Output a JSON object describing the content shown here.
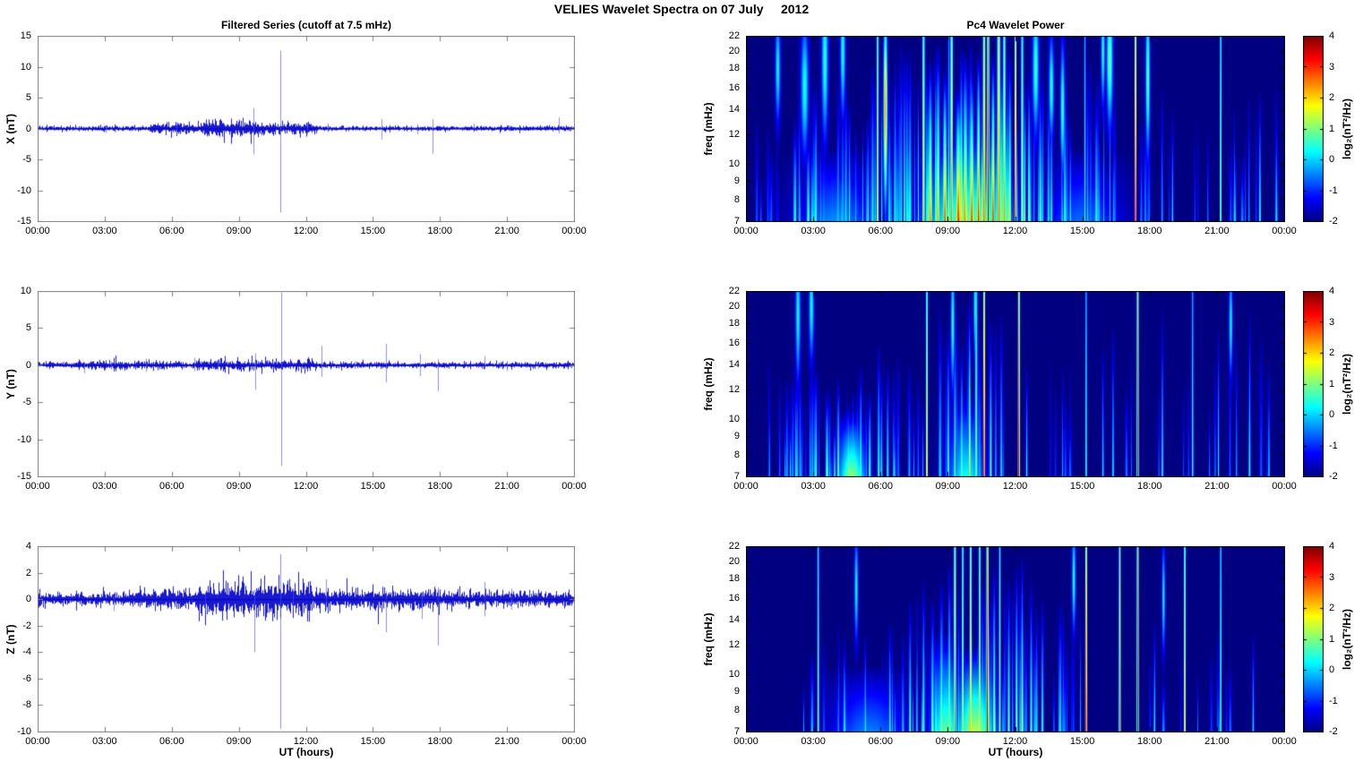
{
  "figure": {
    "title": "VELIES Wavelet Spectra on 07 July     2012",
    "date_shown": "07 July 2012",
    "background": "#ffffff"
  },
  "time_axis": {
    "label": "UT (hours)",
    "range_hours": [
      0,
      24
    ],
    "tick_hours": [
      0,
      3,
      6,
      9,
      12,
      15,
      18,
      21,
      24
    ],
    "tick_labels": [
      "00:00",
      "03:00",
      "06:00",
      "09:00",
      "12:00",
      "15:00",
      "18:00",
      "21:00",
      "00:00"
    ]
  },
  "colorbar": {
    "label": "log₂(nT²/Hz)",
    "clim": [
      -2,
      4
    ],
    "ticks": [
      -2,
      -1,
      0,
      1,
      2,
      3,
      4
    ],
    "colormap": "jet"
  },
  "colors": {
    "series_line": "#0000cc",
    "series_core": "#0000bb",
    "spike_line": "rgba(80,80,235,0.65)",
    "series_axis": "#7d7d7d",
    "spect_axis": "#000000",
    "spect_background_value": -2
  },
  "chart_data": [
    {
      "id": "x-filtered-series",
      "type": "line",
      "title": "Filtered Series (cutoff at 7.5 mHz)",
      "ylabel": "X (nT)",
      "ylim": [
        -15,
        15
      ],
      "yticks": [
        -15,
        -10,
        -5,
        0,
        5,
        10,
        15
      ],
      "x_unit": "UT hours, 0-24",
      "seed": 11,
      "noise": {
        "base": 0.12,
        "bursts": [
          [
            5.0,
            7.3,
            0.28
          ],
          [
            7.3,
            9.9,
            0.42
          ],
          [
            9.9,
            12.5,
            0.32
          ]
        ]
      },
      "spikes": [
        [
          3.05,
          0.5,
          -0.7
        ],
        [
          6.2,
          0.6,
          -1.0
        ],
        [
          9.64,
          3.3,
          -4.2
        ],
        [
          10.87,
          12.6,
          -13.6
        ],
        [
          12.05,
          0.9,
          -0.9
        ],
        [
          13.0,
          0.8,
          -0.6
        ],
        [
          15.4,
          1.5,
          -1.8
        ],
        [
          17.0,
          0.7,
          -0.9
        ],
        [
          17.65,
          1.5,
          -4.1
        ],
        [
          19.5,
          0.8,
          -0.6
        ],
        [
          21.1,
          0.5,
          -0.5
        ],
        [
          23.3,
          1.8,
          -0.8
        ]
      ]
    },
    {
      "id": "y-filtered-series",
      "type": "line",
      "ylabel": "Y (nT)",
      "ylim": [
        -15,
        10
      ],
      "yticks": [
        -15,
        -10,
        -5,
        0,
        5,
        10
      ],
      "x_unit": "UT hours, 0-24",
      "seed": 12,
      "noise": {
        "base": 0.12,
        "bursts": [
          [
            1.8,
            6.5,
            0.18
          ],
          [
            7.0,
            12.5,
            0.22
          ]
        ]
      },
      "spikes": [
        [
          2.1,
          0.4,
          -1.1
        ],
        [
          3.3,
          0.5,
          -0.6
        ],
        [
          4.85,
          0.9,
          -0.9
        ],
        [
          7.0,
          1.0,
          -0.8
        ],
        [
          8.05,
          0.7,
          -0.7
        ],
        [
          9.75,
          1.6,
          -3.3
        ],
        [
          10.9,
          9.8,
          -13.6
        ],
        [
          12.7,
          2.6,
          -1.6
        ],
        [
          14.2,
          0.5,
          -0.5
        ],
        [
          15.6,
          2.9,
          -2.3
        ],
        [
          17.1,
          1.5,
          -1.5
        ],
        [
          17.9,
          0.8,
          -3.5
        ],
        [
          20.0,
          1.2,
          -0.6
        ],
        [
          21.0,
          0.6,
          -0.8
        ],
        [
          22.4,
          0.5,
          -0.5
        ]
      ]
    },
    {
      "id": "z-filtered-series",
      "type": "line",
      "ylabel": "Z (nT)",
      "ylim": [
        -10,
        4
      ],
      "yticks": [
        -10,
        -8,
        -6,
        -4,
        -2,
        0,
        2,
        4
      ],
      "x_unit": "UT hours, 0-24",
      "seed": 13,
      "noise": {
        "base": 0.15,
        "bursts": [
          [
            4.2,
            7.2,
            0.24
          ],
          [
            7.2,
            12.3,
            0.4
          ],
          [
            12.3,
            18.0,
            0.24
          ],
          [
            18.0,
            24.0,
            0.19
          ]
        ]
      },
      "spikes": [
        [
          3.4,
          0.3,
          -0.9
        ],
        [
          7.5,
          0.4,
          -0.9
        ],
        [
          9.7,
          0.7,
          -4.0
        ],
        [
          10.87,
          3.4,
          -9.8
        ],
        [
          11.4,
          0.8,
          -0.6
        ],
        [
          12.9,
          1.5,
          -0.8
        ],
        [
          15.6,
          0.6,
          -2.5
        ],
        [
          17.2,
          0.5,
          -1.5
        ],
        [
          17.9,
          0.9,
          -3.5
        ],
        [
          20.0,
          1.3,
          -1.3
        ],
        [
          21.2,
          0.8,
          -0.8
        ]
      ]
    },
    {
      "id": "x-wavelet-power",
      "type": "heatmap",
      "title": "Pc4 Wavelet Power",
      "ylabel": "freq (mHz)",
      "yscale": "log",
      "ylim_mhz": [
        7,
        22
      ],
      "yticks": [
        7,
        8,
        9,
        10,
        12,
        14,
        16,
        18,
        20,
        22
      ],
      "clim": [
        -2,
        4
      ],
      "seed": 21,
      "events": [
        [
          5.85,
          0.03,
          2.2,
          22
        ],
        [
          7.9,
          0.04,
          2.2,
          22
        ],
        [
          8.2,
          0.06,
          2.6,
          19
        ],
        [
          8.55,
          0.05,
          2.4,
          21
        ],
        [
          8.85,
          0.06,
          3.0,
          18
        ],
        [
          9.15,
          0.04,
          2.6,
          22
        ],
        [
          9.45,
          0.08,
          3.2,
          16
        ],
        [
          9.75,
          0.05,
          2.8,
          20
        ],
        [
          10.05,
          0.06,
          3.1,
          18
        ],
        [
          10.35,
          0.05,
          3.3,
          20
        ],
        [
          10.6,
          0.04,
          3.0,
          22
        ],
        [
          10.78,
          0.035,
          4.0,
          22
        ],
        [
          11.0,
          0.05,
          3.2,
          20
        ],
        [
          11.25,
          0.05,
          2.8,
          22
        ],
        [
          11.5,
          0.04,
          2.4,
          22
        ],
        [
          11.75,
          0.04,
          2.0,
          20
        ],
        [
          12.0,
          0.03,
          3.6,
          22
        ],
        [
          12.3,
          0.04,
          1.8,
          22
        ],
        [
          12.6,
          0.04,
          1.4,
          18
        ],
        [
          13.1,
          0.04,
          1.0,
          18
        ],
        [
          13.6,
          0.04,
          0.6,
          16
        ],
        [
          14.2,
          0.04,
          0.8,
          18
        ],
        [
          15.1,
          0.025,
          0.9,
          22
        ],
        [
          15.6,
          0.04,
          0.7,
          16
        ],
        [
          17.35,
          0.03,
          3.8,
          22
        ],
        [
          19.0,
          0.03,
          0.3,
          14
        ],
        [
          21.15,
          0.025,
          1.8,
          22
        ],
        [
          22.9,
          0.03,
          0.8,
          16
        ]
      ],
      "wide": [
        [
          9.9,
          1.5,
          0.9,
          12.5
        ],
        [
          4.0,
          1.2,
          -0.4,
          11
        ],
        [
          15.0,
          1.2,
          -0.6,
          11
        ]
      ],
      "blobs": [
        [
          16.2,
          0.1,
          0.9,
          19,
          0.25
        ],
        [
          17.9,
          0.07,
          0.8,
          17,
          0.3
        ],
        [
          15.9,
          0.06,
          0.5,
          20,
          0.2
        ],
        [
          2.6,
          0.12,
          0.4,
          16,
          0.25
        ],
        [
          1.4,
          0.08,
          0.3,
          18,
          0.2
        ],
        [
          12.9,
          0.1,
          0.6,
          18,
          0.25
        ],
        [
          13.6,
          0.08,
          0.5,
          16,
          0.2
        ],
        [
          14.1,
          0.07,
          0.6,
          14,
          0.25
        ],
        [
          3.5,
          0.1,
          0.5,
          19,
          0.3
        ],
        [
          4.3,
          0.08,
          0.4,
          20,
          0.25
        ],
        [
          6.2,
          0.06,
          2.4,
          14,
          0.35
        ]
      ],
      "texture": [
        [
          0.3,
          2.0,
          10,
          -1.2,
          -0.4,
          9,
          14
        ],
        [
          2.0,
          5.5,
          30,
          -0.6,
          0.9,
          10,
          18
        ],
        [
          5.5,
          7.5,
          24,
          -0.4,
          1.2,
          12,
          22
        ],
        [
          7.5,
          12.8,
          60,
          -0.2,
          2.0,
          13,
          22
        ],
        [
          12.8,
          16.5,
          28,
          -0.7,
          0.7,
          10,
          20
        ],
        [
          16.5,
          20.5,
          8,
          -0.9,
          0.2,
          11,
          19
        ],
        [
          20.5,
          23.8,
          12,
          -0.8,
          0.4,
          10,
          17
        ]
      ]
    },
    {
      "id": "y-wavelet-power",
      "type": "heatmap",
      "ylabel": "freq (mHz)",
      "yscale": "log",
      "ylim_mhz": [
        7,
        22
      ],
      "yticks": [
        7,
        8,
        9,
        10,
        12,
        14,
        16,
        18,
        20,
        22
      ],
      "clim": [
        -2,
        4
      ],
      "seed": 22,
      "events": [
        [
          2.2,
          0.03,
          0.5,
          13
        ],
        [
          3.1,
          0.04,
          0.8,
          14
        ],
        [
          3.6,
          0.05,
          1.0,
          12
        ],
        [
          4.1,
          0.04,
          1.2,
          13
        ],
        [
          4.55,
          0.05,
          1.3,
          11
        ],
        [
          4.8,
          0.06,
          1.2,
          10.5
        ],
        [
          5.1,
          0.04,
          1.0,
          14
        ],
        [
          5.5,
          0.04,
          1.1,
          12
        ],
        [
          5.9,
          0.04,
          0.8,
          16
        ],
        [
          6.3,
          0.04,
          0.6,
          14
        ],
        [
          8.05,
          0.03,
          2.4,
          22
        ],
        [
          9.0,
          0.04,
          0.9,
          18
        ],
        [
          9.3,
          0.04,
          1.0,
          20
        ],
        [
          9.6,
          0.04,
          1.1,
          16
        ],
        [
          9.95,
          0.035,
          2.2,
          21
        ],
        [
          10.25,
          0.04,
          1.2,
          22
        ],
        [
          10.6,
          0.03,
          3.7,
          22
        ],
        [
          10.9,
          0.035,
          1.0,
          18
        ],
        [
          12.15,
          0.03,
          3.8,
          22
        ],
        [
          12.5,
          0.03,
          0.6,
          14
        ],
        [
          15.15,
          0.025,
          1.0,
          22
        ],
        [
          15.9,
          0.03,
          0.4,
          16
        ],
        [
          16.35,
          0.03,
          0.5,
          18
        ],
        [
          17.45,
          0.03,
          3.6,
          22
        ],
        [
          18.55,
          0.03,
          0.6,
          20
        ],
        [
          19.9,
          0.025,
          0.8,
          22
        ],
        [
          21.05,
          0.025,
          0.6,
          18
        ],
        [
          22.45,
          0.025,
          0.7,
          20
        ],
        [
          23.3,
          0.03,
          0.3,
          14
        ]
      ],
      "wide": [
        [
          4.7,
          0.45,
          1.1,
          10.5
        ],
        [
          9.8,
          0.6,
          0.3,
          12
        ]
      ],
      "blobs": [
        [
          2.3,
          0.08,
          0.3,
          19,
          0.25
        ],
        [
          2.9,
          0.08,
          0.35,
          20,
          0.2
        ],
        [
          9.2,
          0.06,
          0.5,
          18,
          0.25
        ],
        [
          10.2,
          0.05,
          0.4,
          20,
          0.2
        ],
        [
          21.6,
          0.06,
          0.3,
          18,
          0.2
        ]
      ],
      "texture": [
        [
          1.0,
          6.6,
          34,
          -0.6,
          0.8,
          9,
          16
        ],
        [
          6.6,
          8.0,
          8,
          -0.8,
          0.2,
          10,
          15
        ],
        [
          8.6,
          11.5,
          20,
          -0.5,
          0.8,
          12,
          22
        ],
        [
          12.3,
          14.8,
          7,
          -0.9,
          0.0,
          10,
          16
        ],
        [
          15.3,
          23.5,
          12,
          -0.9,
          0.1,
          10,
          18
        ]
      ]
    },
    {
      "id": "z-wavelet-power",
      "type": "heatmap",
      "ylabel": "freq (mHz)",
      "yscale": "log",
      "ylim_mhz": [
        7,
        22
      ],
      "yticks": [
        7,
        8,
        9,
        10,
        12,
        14,
        16,
        18,
        20,
        22
      ],
      "clim": [
        -2,
        4
      ],
      "seed": 23,
      "events": [
        [
          3.2,
          0.03,
          1.4,
          22
        ],
        [
          4.4,
          0.03,
          0.5,
          12
        ],
        [
          5.3,
          0.03,
          0.6,
          13
        ],
        [
          6.4,
          0.035,
          0.8,
          14
        ],
        [
          7.3,
          0.04,
          0.9,
          16
        ],
        [
          7.9,
          0.04,
          1.0,
          18
        ],
        [
          8.3,
          0.05,
          1.2,
          16
        ],
        [
          8.7,
          0.05,
          1.4,
          18
        ],
        [
          9.05,
          0.04,
          1.6,
          20
        ],
        [
          9.3,
          0.035,
          2.6,
          22
        ],
        [
          9.65,
          0.03,
          2.0,
          22
        ],
        [
          10.0,
          0.035,
          2.6,
          22
        ],
        [
          10.4,
          0.03,
          2.2,
          22
        ],
        [
          10.75,
          0.035,
          4.0,
          22
        ],
        [
          11.05,
          0.04,
          1.6,
          20
        ],
        [
          11.3,
          0.03,
          1.6,
          22
        ],
        [
          11.7,
          0.04,
          1.2,
          18
        ],
        [
          12.05,
          0.04,
          1.4,
          20
        ],
        [
          12.3,
          0.035,
          1.8,
          21
        ],
        [
          12.7,
          0.04,
          1.0,
          18
        ],
        [
          13.2,
          0.04,
          0.8,
          16
        ],
        [
          14.0,
          0.035,
          0.6,
          16
        ],
        [
          15.15,
          0.03,
          3.7,
          22
        ],
        [
          16.65,
          0.03,
          2.6,
          22
        ],
        [
          17.45,
          0.03,
          3.8,
          22
        ],
        [
          18.2,
          0.03,
          0.5,
          14
        ],
        [
          19.55,
          0.03,
          2.4,
          22
        ],
        [
          21.15,
          0.025,
          1.3,
          22
        ],
        [
          22.6,
          0.03,
          0.4,
          13
        ]
      ],
      "wide": [
        [
          10.2,
          0.65,
          1.3,
          12
        ],
        [
          8.9,
          0.5,
          0.8,
          13
        ],
        [
          5.5,
          1.2,
          -0.5,
          10.5
        ]
      ],
      "blobs": [
        [
          4.9,
          0.06,
          0.3,
          17,
          0.2
        ],
        [
          14.6,
          0.06,
          0.4,
          18,
          0.2
        ],
        [
          18.6,
          0.05,
          0.3,
          16,
          0.2
        ]
      ],
      "texture": [
        [
          2.5,
          7.5,
          16,
          -0.8,
          0.3,
          9,
          14
        ],
        [
          7.5,
          13.2,
          42,
          -0.3,
          1.1,
          10,
          19
        ],
        [
          13.2,
          15.0,
          9,
          -0.8,
          0.2,
          10,
          16
        ],
        [
          17.8,
          23.5,
          9,
          -0.9,
          0.1,
          9,
          14
        ]
      ]
    }
  ]
}
